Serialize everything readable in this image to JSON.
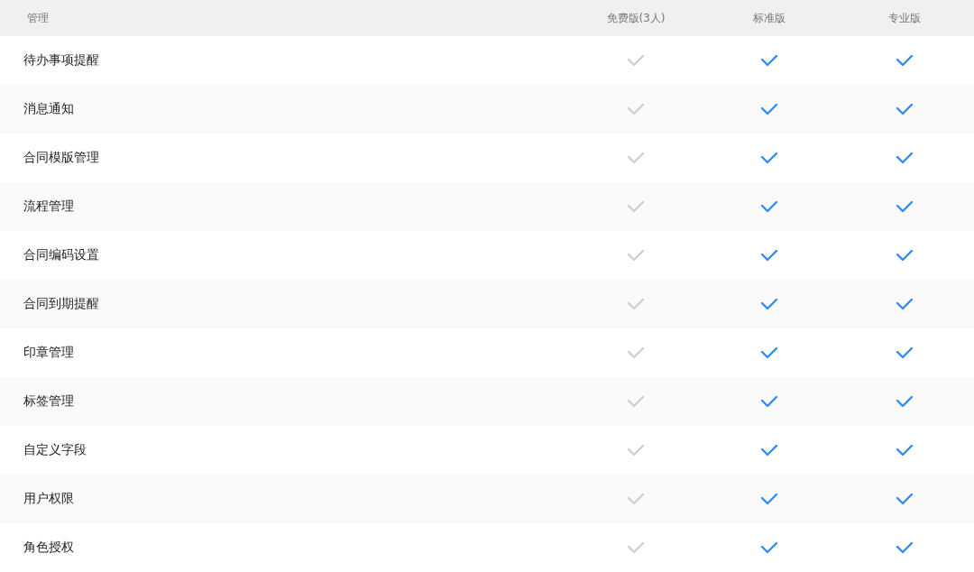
{
  "table": {
    "columns": [
      "管理",
      "免费版(3人)",
      "标准版",
      "专业版"
    ],
    "rows": [
      {
        "feature": "待办事项提醒",
        "cells": [
          {
            "active": false
          },
          {
            "active": true
          },
          {
            "active": true
          }
        ]
      },
      {
        "feature": "消息通知",
        "cells": [
          {
            "active": false
          },
          {
            "active": true
          },
          {
            "active": true
          }
        ]
      },
      {
        "feature": "合同模版管理",
        "cells": [
          {
            "active": false
          },
          {
            "active": true
          },
          {
            "active": true
          }
        ]
      },
      {
        "feature": "流程管理",
        "cells": [
          {
            "active": false
          },
          {
            "active": true
          },
          {
            "active": true
          }
        ]
      },
      {
        "feature": "合同编码设置",
        "cells": [
          {
            "active": false
          },
          {
            "active": true
          },
          {
            "active": true
          }
        ]
      },
      {
        "feature": "合同到期提醒",
        "cells": [
          {
            "active": false
          },
          {
            "active": true
          },
          {
            "active": true
          }
        ]
      },
      {
        "feature": "印章管理",
        "cells": [
          {
            "active": false
          },
          {
            "active": true
          },
          {
            "active": true
          }
        ]
      },
      {
        "feature": "标签管理",
        "cells": [
          {
            "active": false
          },
          {
            "active": true
          },
          {
            "active": true
          }
        ]
      },
      {
        "feature": "自定义字段",
        "cells": [
          {
            "active": false
          },
          {
            "active": true
          },
          {
            "active": true
          }
        ]
      },
      {
        "feature": "用户权限",
        "cells": [
          {
            "active": false
          },
          {
            "active": true
          },
          {
            "active": true
          }
        ]
      },
      {
        "feature": "角色授权",
        "cells": [
          {
            "active": false
          },
          {
            "active": true
          },
          {
            "active": true
          }
        ]
      }
    ]
  }
}
